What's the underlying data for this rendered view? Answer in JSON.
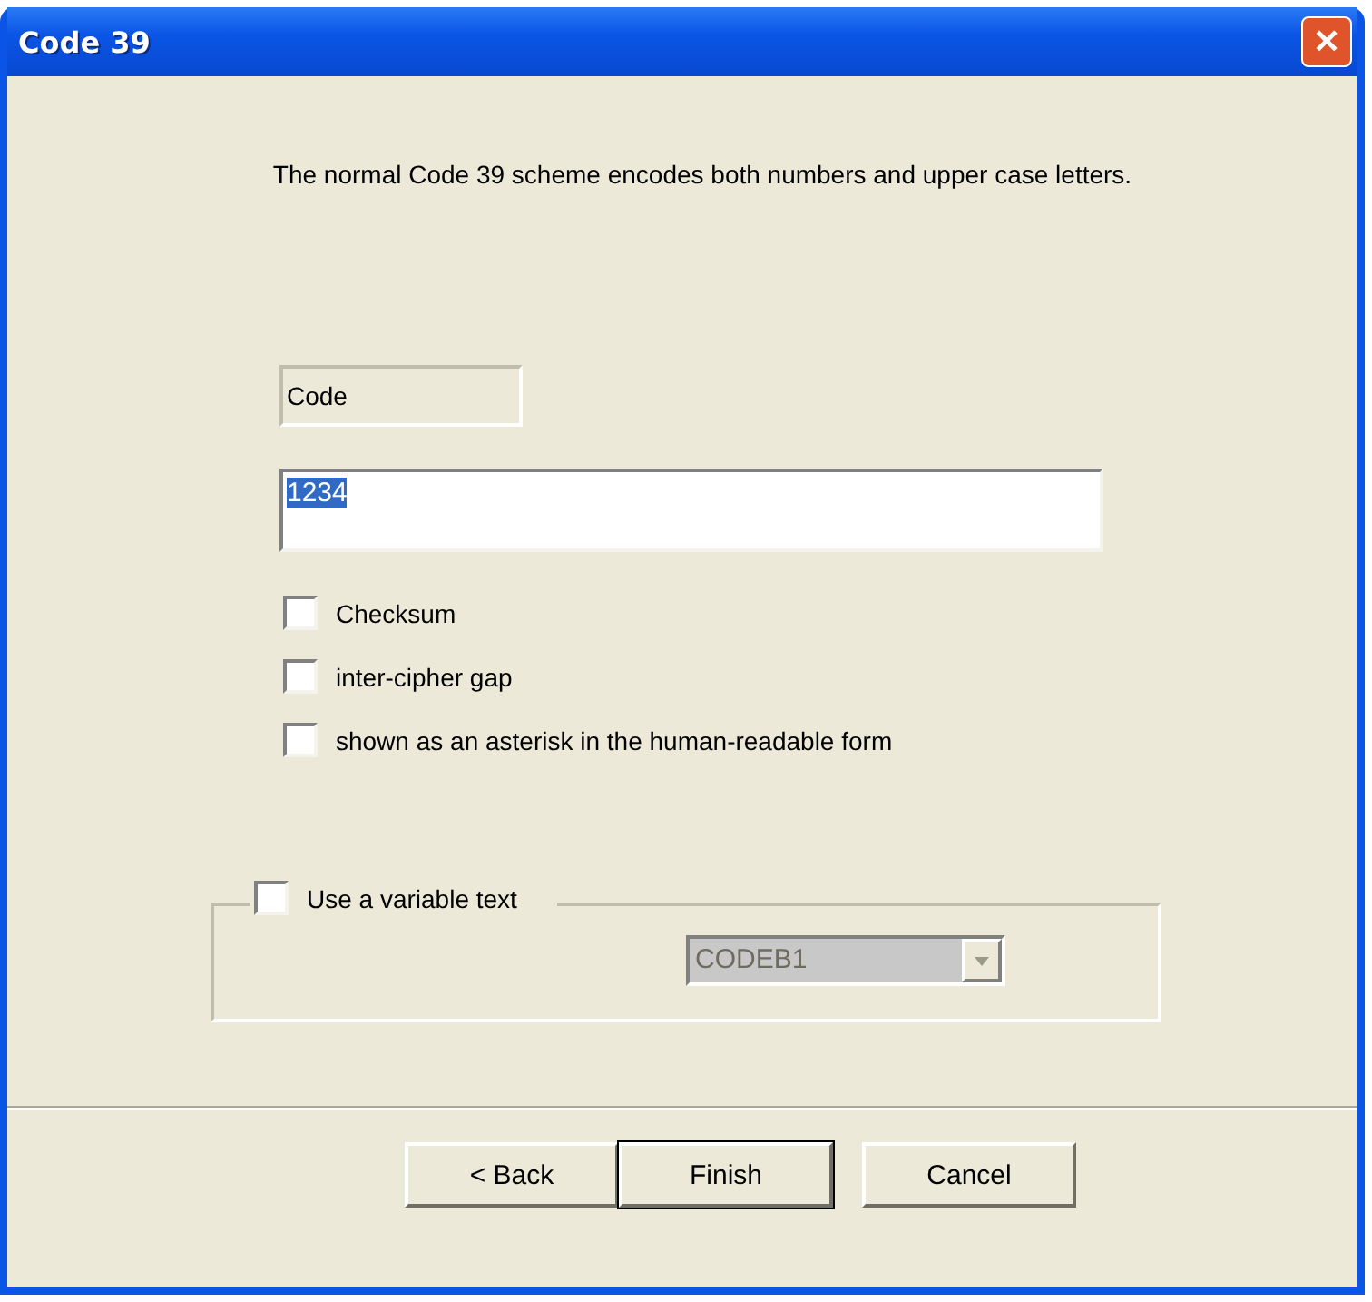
{
  "window": {
    "title": "Code 39",
    "close": "✕"
  },
  "description": "The normal Code 39 scheme encodes both numbers and upper case letters.",
  "code": {
    "label": "Code",
    "value": "1234",
    "selected_text": true
  },
  "options": [
    {
      "label": "Checksum",
      "checked": false
    },
    {
      "label": " inter-cipher gap",
      "checked": false
    },
    {
      "label": "shown as an asterisk in the human-readable form",
      "checked": false
    }
  ],
  "variable_text": {
    "label": "Use a variable text",
    "checked": false,
    "dropdown": {
      "value": "CODEB1",
      "disabled": true
    }
  },
  "buttons": [
    {
      "label": "< Back",
      "default": false
    },
    {
      "label": "Finish",
      "default": true
    },
    {
      "label": "Cancel",
      "default": false
    }
  ]
}
